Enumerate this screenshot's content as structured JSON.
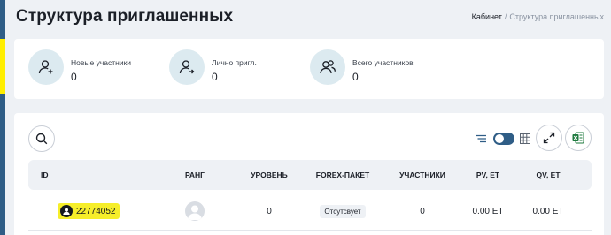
{
  "page": {
    "title": "Структура приглашенных",
    "breadcrumb": {
      "home": "Кабинет",
      "separator": "/",
      "current": "Структура приглашенных"
    }
  },
  "stats": [
    {
      "label": "Новые участники",
      "value": "0",
      "icon": "user-plus-icon"
    },
    {
      "label": "Лично пригл.",
      "value": "0",
      "icon": "user-arrow-icon"
    },
    {
      "label": "Всего участников",
      "value": "0",
      "icon": "users-icon"
    }
  ],
  "toolbar": {
    "search_icon": "search-icon",
    "filter_icon": "filter-lines-icon",
    "toggle": "on",
    "grid_icon": "grid-icon",
    "expand_icon": "expand-icon",
    "excel_icon": "excel-icon"
  },
  "table": {
    "columns": [
      "ID",
      "РАНГ",
      "УРОВЕНЬ",
      "FOREX-ПАКЕТ",
      "УЧАСТНИКИ",
      "PV, ET",
      "QV, ET"
    ],
    "rows": [
      {
        "id": "22774052",
        "rank": "avatar-placeholder",
        "level": "0",
        "forex": "Отсутсвует",
        "participants": "0",
        "pv": "0.00 ET",
        "qv": "0.00 ET"
      }
    ]
  },
  "colors": {
    "accent": "#2f5d86",
    "highlight": "#f6ee2a",
    "icon_circle": "#dceaf0",
    "background": "#eef1f5",
    "excel_green": "#1e7a3e"
  }
}
